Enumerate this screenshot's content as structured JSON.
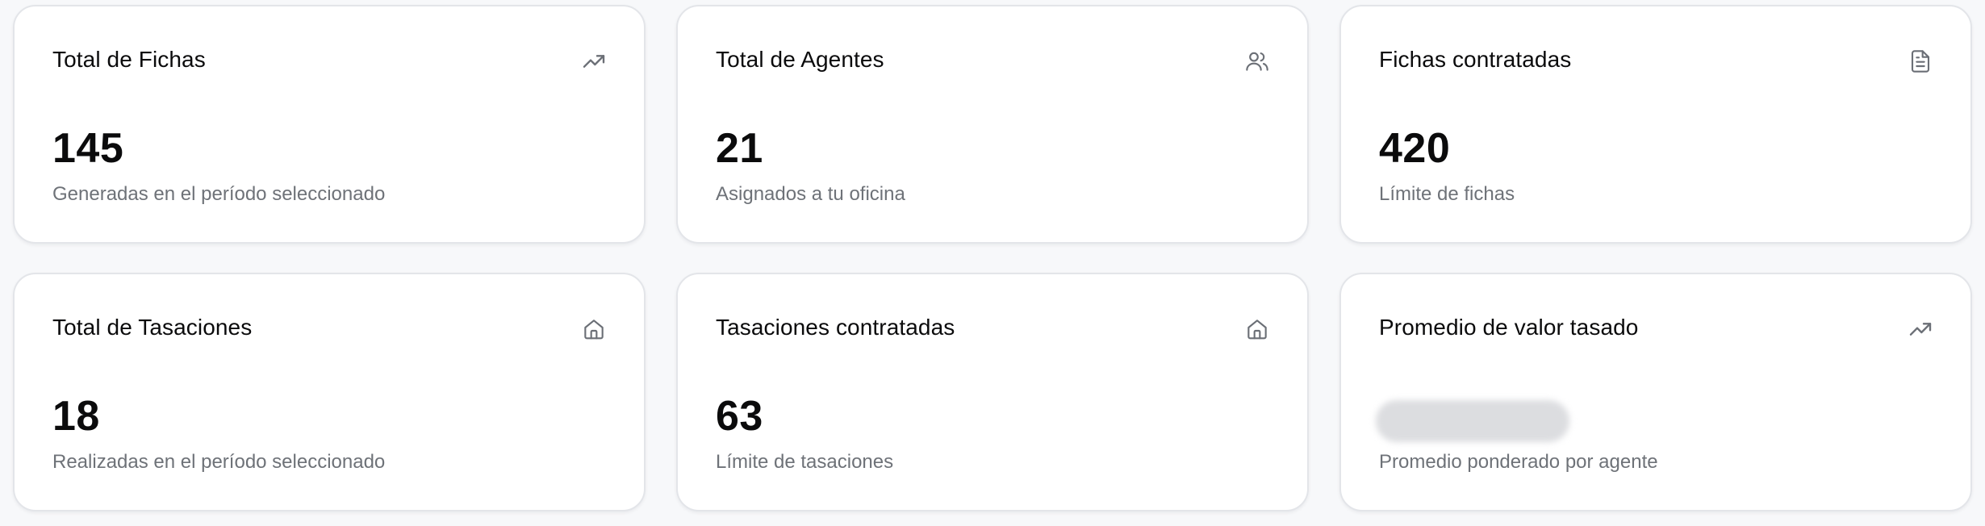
{
  "cards": [
    {
      "title": "Total de Fichas",
      "value": "145",
      "subtitle": "Generadas en el período seleccionado",
      "icon": "trending-up-icon"
    },
    {
      "title": "Total de Agentes",
      "value": "21",
      "subtitle": "Asignados a tu oficina",
      "icon": "users-icon"
    },
    {
      "title": "Fichas contratadas",
      "value": "420",
      "subtitle": "Límite de fichas",
      "icon": "file-text-icon"
    },
    {
      "title": "Total de Tasaciones",
      "value": "18",
      "subtitle": "Realizadas en el período seleccionado",
      "icon": "home-icon"
    },
    {
      "title": "Tasaciones contratadas",
      "value": "63",
      "subtitle": "Límite de tasaciones",
      "icon": "home-icon"
    },
    {
      "title": "Promedio de valor tasado",
      "value": "",
      "subtitle": "Promedio ponderado por agente",
      "icon": "trending-up-icon",
      "value_blurred": true
    }
  ],
  "colors": {
    "background": "#f7f8fa",
    "card_background": "#ffffff",
    "card_border": "#e3e5e9",
    "title_text": "#0b0b0c",
    "subtitle_text": "#6e7278",
    "icon": "#6b6f76"
  }
}
